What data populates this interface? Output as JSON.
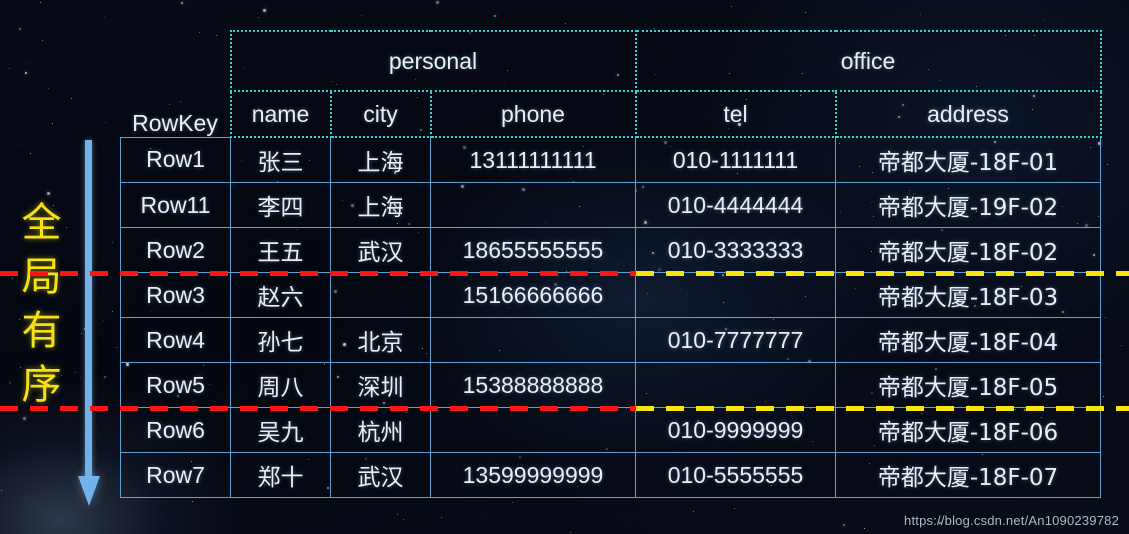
{
  "annotation": {
    "order_label": "全\n局\n有\n序",
    "arrow_icon": "down-arrow-icon",
    "arrow_color": "#72b2e8",
    "label_color": "#f5e215"
  },
  "table": {
    "rowkey_header": "RowKey",
    "column_families": [
      {
        "name": "personal",
        "span": 3
      },
      {
        "name": "office",
        "span": 2
      }
    ],
    "columns": [
      "name",
      "city",
      "phone",
      "tel",
      "address"
    ],
    "rows": [
      {
        "rowkey": "Row1",
        "name": "张三",
        "city": "上海",
        "phone": "13111111111",
        "tel": "010-1111111",
        "address": "帝都大厦-18F-01"
      },
      {
        "rowkey": "Row11",
        "name": "李四",
        "city": "上海",
        "phone": "",
        "tel": "010-4444444",
        "address": "帝都大厦-19F-02"
      },
      {
        "rowkey": "Row2",
        "name": "王五",
        "city": "武汉",
        "phone": "18655555555",
        "tel": "010-3333333",
        "address": "帝都大厦-18F-02"
      },
      {
        "rowkey": "Row3",
        "name": "赵六",
        "city": "",
        "phone": "15166666666",
        "tel": "",
        "address": "帝都大厦-18F-03"
      },
      {
        "rowkey": "Row4",
        "name": "孙七",
        "city": "北京",
        "phone": "",
        "tel": "010-7777777",
        "address": "帝都大厦-18F-04"
      },
      {
        "rowkey": "Row5",
        "name": "周八",
        "city": "深圳",
        "phone": "15388888888",
        "tel": "",
        "address": "帝都大厦-18F-05"
      },
      {
        "rowkey": "Row6",
        "name": "吴九",
        "city": "杭州",
        "phone": "",
        "tel": "010-9999999",
        "address": "帝都大厦-18F-06"
      },
      {
        "rowkey": "Row7",
        "name": "郑十",
        "city": "武汉",
        "phone": "13599999999",
        "tel": "010-5555555",
        "address": "帝都大厦-18F-07"
      }
    ]
  },
  "split_lines": [
    {
      "name": "region-split-1",
      "after_row_index": 2,
      "red_color": "#ff1414",
      "yellow_color": "#f7e60e"
    },
    {
      "name": "region-split-2",
      "after_row_index": 5,
      "red_color": "#ff1414",
      "yellow_color": "#f7e60e"
    }
  ],
  "watermark": {
    "text": "https://blog.csdn.net/An1090239782"
  }
}
